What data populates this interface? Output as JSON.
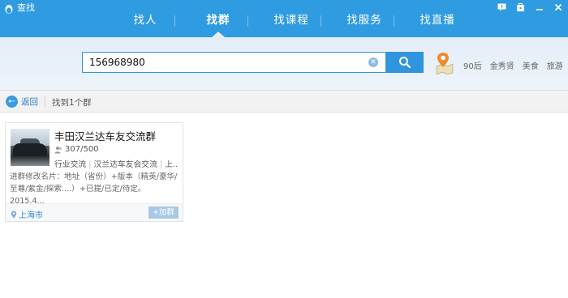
{
  "window": {
    "title": "查找",
    "controls": [
      "feedback-icon",
      "skin-icon",
      "minimize-icon",
      "close-icon"
    ]
  },
  "tabs": [
    {
      "label": "找人",
      "active": false
    },
    {
      "label": "找群",
      "active": true
    },
    {
      "label": "找课程",
      "active": false
    },
    {
      "label": "找服务",
      "active": false
    },
    {
      "label": "找直播",
      "active": false
    }
  ],
  "search": {
    "value": "156968980",
    "placeholder": ""
  },
  "quick_links": [
    "90后",
    "金秀贤",
    "美食",
    "旅游"
  ],
  "results_bar": {
    "back_label": "返回",
    "found_text": "找到1个群"
  },
  "result": {
    "name": "丰田汉兰达车友交流群",
    "members": "307/500",
    "tags": [
      "行业交流",
      "汉兰达车友会交流",
      "上..."
    ],
    "description": "进群修改名片：地址（省份）+版本（精英/豪华/至尊/紫金/探索....）+已提/已定/待定。2015.4...",
    "location": "上海市",
    "join_label": "+加群"
  },
  "colors": {
    "accent": "#2f9be0",
    "search_button": "#2f95df",
    "link": "#2f86d1"
  }
}
